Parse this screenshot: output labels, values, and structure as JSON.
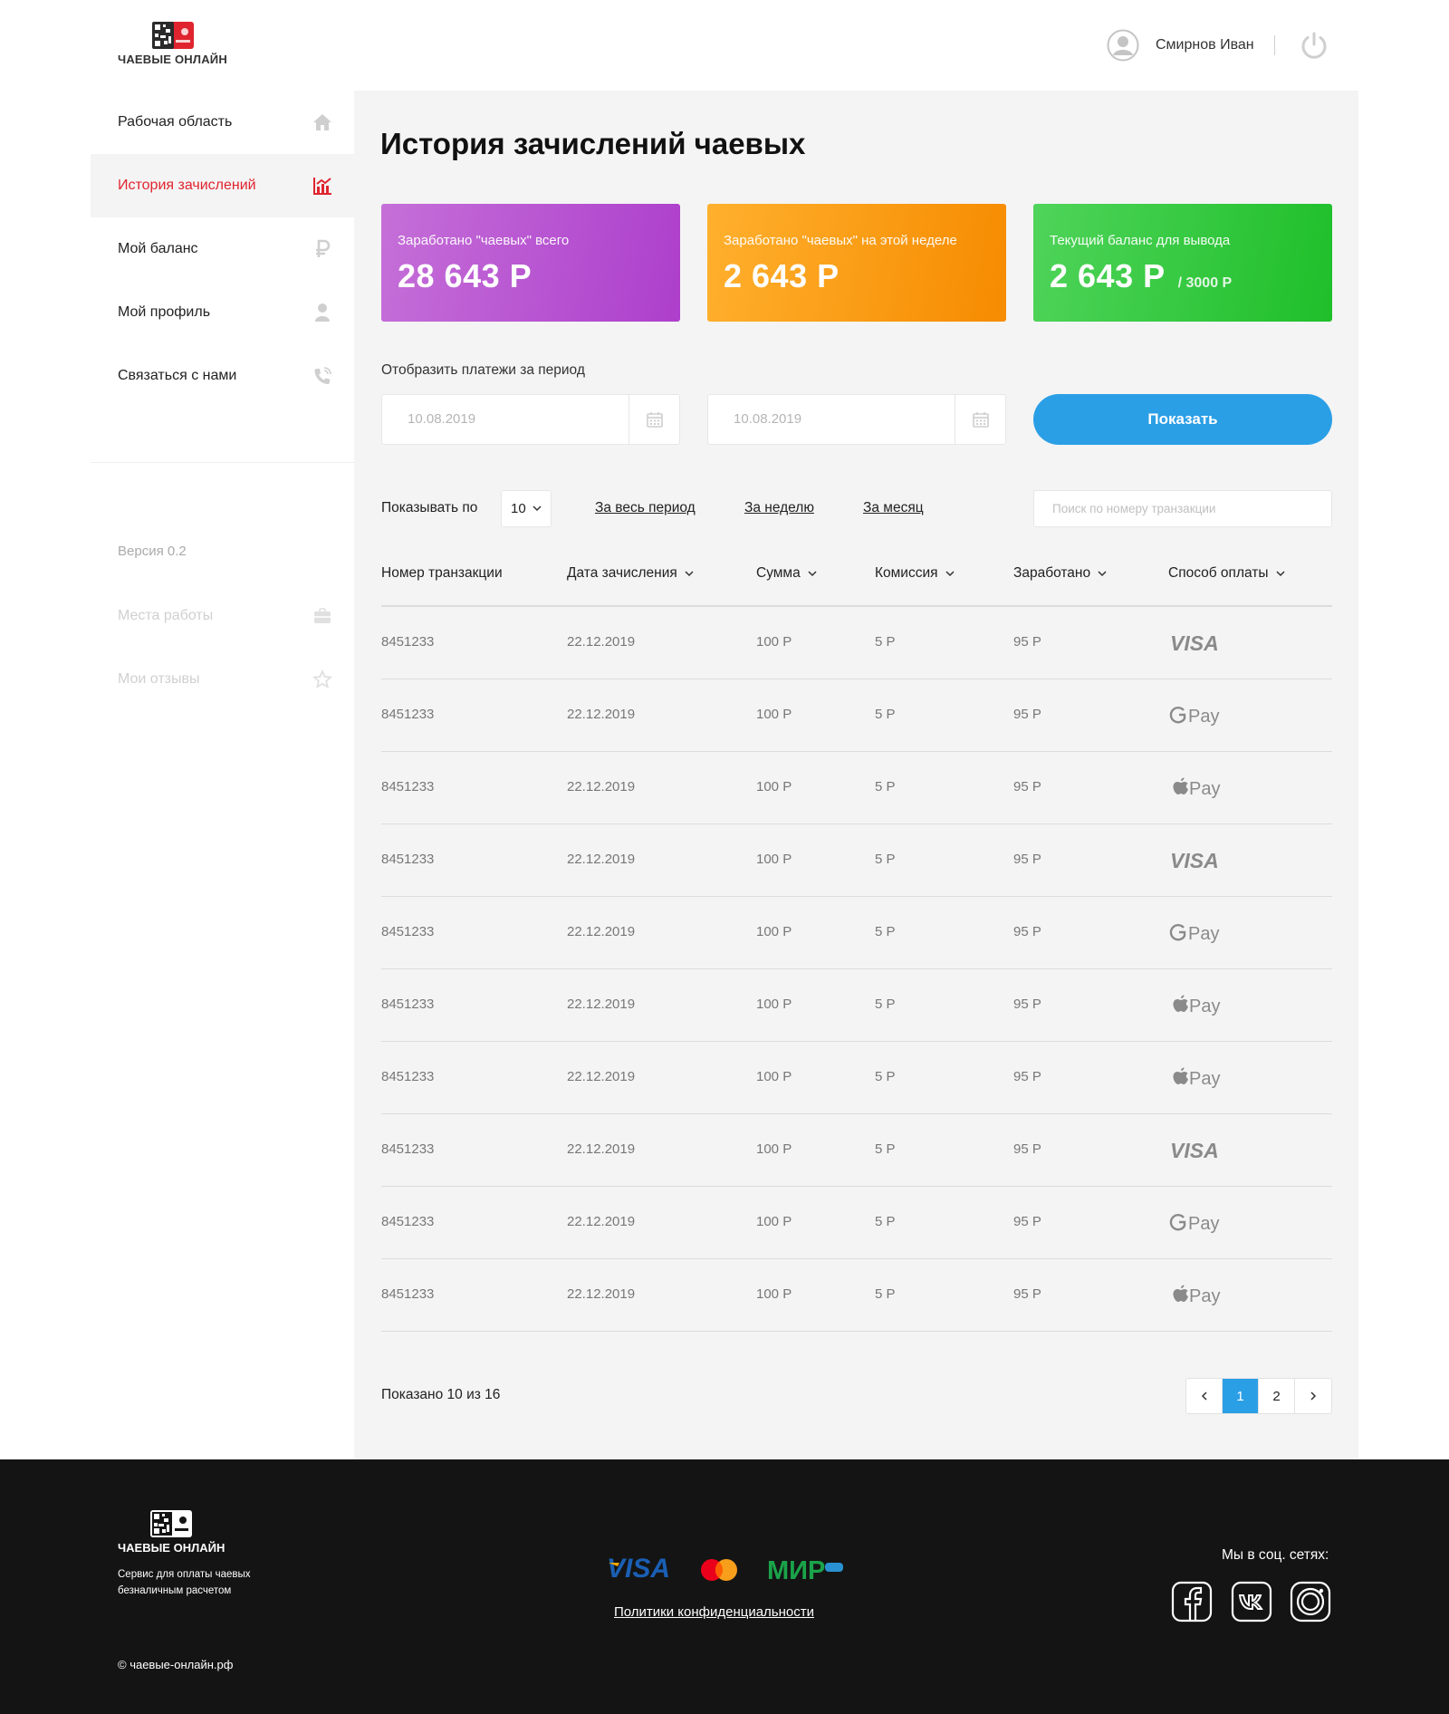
{
  "header": {
    "logo_text": "ЧАЕВЫЕ ОНЛАЙН",
    "user_name": "Смирнов Иван"
  },
  "sidebar": {
    "items": [
      {
        "label": "Рабочая область",
        "icon": "home-icon",
        "active": false
      },
      {
        "label": "История зачислений",
        "icon": "chart-icon",
        "active": true
      },
      {
        "label": "Мой баланс",
        "icon": "ruble-icon",
        "active": false
      },
      {
        "label": "Мой профиль",
        "icon": "user-icon",
        "active": false
      },
      {
        "label": "Связаться с нами",
        "icon": "phone-icon",
        "active": false
      }
    ],
    "version": "Версия 0.2",
    "disabled_items": [
      {
        "label": "Места работы",
        "icon": "briefcase-icon"
      },
      {
        "label": "Мои отзывы",
        "icon": "star-icon"
      }
    ]
  },
  "main": {
    "title": "История зачислений чаевых",
    "cards": [
      {
        "label": "Заработано \"чаевых\" всего",
        "value": "28 643 Р",
        "color_from": "#c56fd8",
        "color_to": "#ad3fcc"
      },
      {
        "label": "Заработано \"чаевых\" на этой неделе",
        "value": "2 643 Р",
        "color_from": "#ffb02e",
        "color_to": "#f68b00"
      },
      {
        "label": "Текущий баланс для вывода",
        "value": "2 643 Р",
        "limit": "/ 3000 Р",
        "color_from": "#4fd45a",
        "color_to": "#1fbf2a"
      }
    ],
    "period_label": "Отобразить платежи за период",
    "date_from": "10.08.2019",
    "date_to": "10.08.2019",
    "show_button": "Показать",
    "per_page_label": "Показывать по",
    "per_page_value": "10",
    "filters": [
      "За весь период",
      "За неделю",
      "За месяц"
    ],
    "search_placeholder": "Поиск по номеру транзакции",
    "columns": [
      "Номер транзакции",
      "Дата зачисления",
      "Сумма",
      "Комиссия",
      "Заработано",
      "Способ оплаты"
    ],
    "rows": [
      {
        "id": "8451233",
        "date": "22.12.2019",
        "sum": "100 Р",
        "fee": "5 Р",
        "earned": "95 Р",
        "method": "VISA"
      },
      {
        "id": "8451233",
        "date": "22.12.2019",
        "sum": "100 Р",
        "fee": "5 Р",
        "earned": "95 Р",
        "method": "Google Pay"
      },
      {
        "id": "8451233",
        "date": "22.12.2019",
        "sum": "100 Р",
        "fee": "5 Р",
        "earned": "95 Р",
        "method": "Apple Pay"
      },
      {
        "id": "8451233",
        "date": "22.12.2019",
        "sum": "100 Р",
        "fee": "5 Р",
        "earned": "95 Р",
        "method": "VISA"
      },
      {
        "id": "8451233",
        "date": "22.12.2019",
        "sum": "100 Р",
        "fee": "5 Р",
        "earned": "95 Р",
        "method": "Google Pay"
      },
      {
        "id": "8451233",
        "date": "22.12.2019",
        "sum": "100 Р",
        "fee": "5 Р",
        "earned": "95 Р",
        "method": "Apple Pay"
      },
      {
        "id": "8451233",
        "date": "22.12.2019",
        "sum": "100 Р",
        "fee": "5 Р",
        "earned": "95 Р",
        "method": "Apple Pay"
      },
      {
        "id": "8451233",
        "date": "22.12.2019",
        "sum": "100 Р",
        "fee": "5 Р",
        "earned": "95 Р",
        "method": "VISA"
      },
      {
        "id": "8451233",
        "date": "22.12.2019",
        "sum": "100 Р",
        "fee": "5 Р",
        "earned": "95 Р",
        "method": "Google Pay"
      },
      {
        "id": "8451233",
        "date": "22.12.2019",
        "sum": "100 Р",
        "fee": "5 Р",
        "earned": "95 Р",
        "method": "Apple Pay"
      }
    ],
    "shown_text": "Показано 10 из 16",
    "pager": {
      "pages": [
        "1",
        "2"
      ],
      "current": "1"
    }
  },
  "footer": {
    "logo_text": "ЧАЕВЫЕ ОНЛАЙН",
    "description": "Сервис для оплаты чаевых безналичным расчетом",
    "copyright": "© чаевые-онлайн.рф",
    "payment_logos": [
      "VISA",
      "Mastercard",
      "МИР"
    ],
    "policy_link": "Политики конфиденциальности",
    "social_label": "Мы в соц. сетях:",
    "social": [
      "facebook-icon",
      "vk-icon",
      "instagram-icon"
    ],
    "accent_red": "#e0242f",
    "accent_blue": "#2b9fe6"
  }
}
